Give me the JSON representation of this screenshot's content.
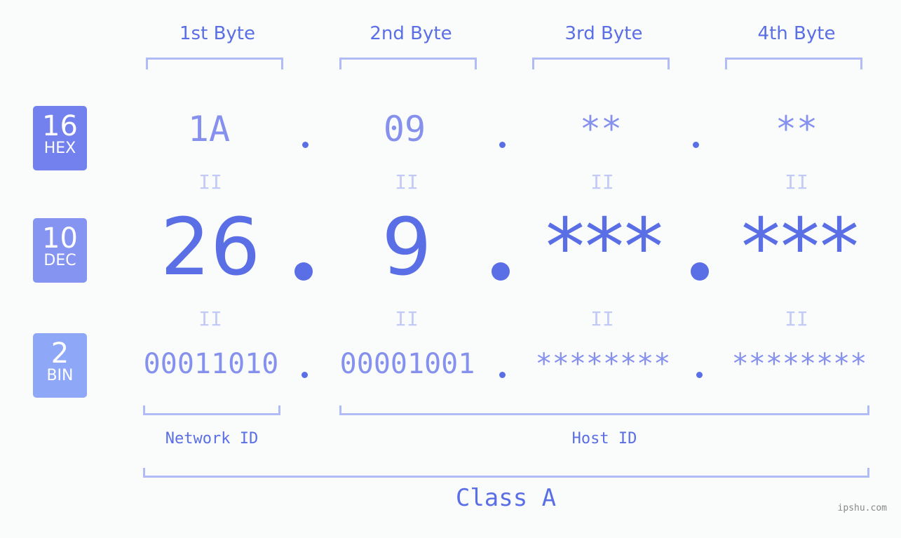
{
  "headers": [
    "1st Byte",
    "2nd Byte",
    "3rd Byte",
    "4th Byte"
  ],
  "rows": {
    "hex": {
      "base": "16",
      "label": "HEX",
      "values": [
        "1A",
        "09",
        "**",
        "**"
      ],
      "color": "#7281ed"
    },
    "dec": {
      "base": "10",
      "label": "DEC",
      "values": [
        "26",
        "9",
        "***",
        "***"
      ],
      "color": "#8593f1"
    },
    "bin": {
      "base": "2",
      "label": "BIN",
      "values": [
        "00011010",
        "00001001",
        "********",
        "********"
      ],
      "color": "#8ea7f6"
    }
  },
  "equals_glyph": "II",
  "network_id_label": "Network ID",
  "host_id_label": "Host ID",
  "class_label": "Class A",
  "watermark": "ipshu.com",
  "colors": {
    "accent": "#5a6ee6",
    "light_value": "#8591ec",
    "bracket": "#b1bcf6",
    "equals": "#c2cbf8",
    "background": "#fafcfb"
  }
}
